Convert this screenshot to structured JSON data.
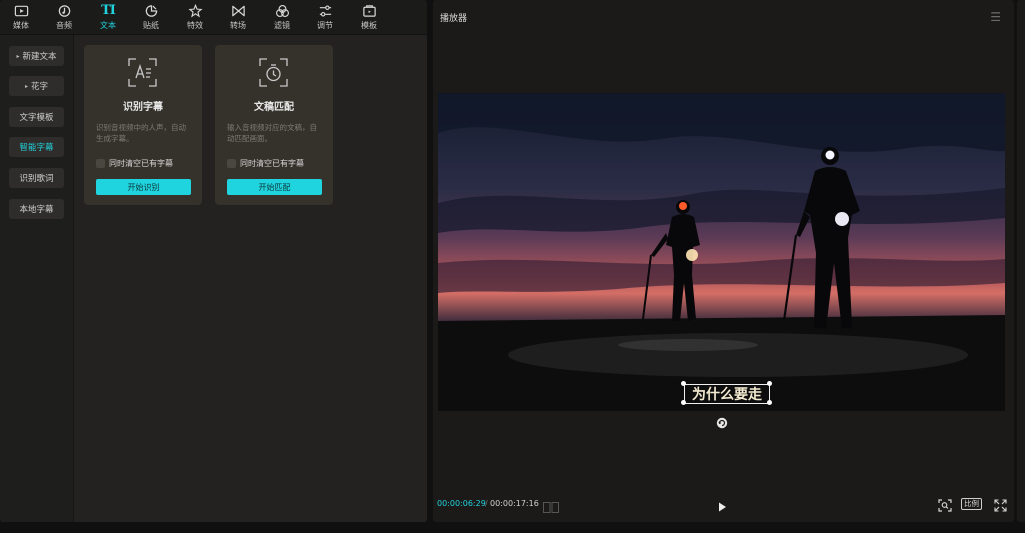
{
  "toolbar": {
    "tabs": [
      {
        "label": "媒体",
        "icon": "media-icon"
      },
      {
        "label": "音频",
        "icon": "audio-icon"
      },
      {
        "label": "文本",
        "icon": "text-icon",
        "active": true
      },
      {
        "label": "贴纸",
        "icon": "sticker-icon"
      },
      {
        "label": "特效",
        "icon": "effects-icon"
      },
      {
        "label": "转场",
        "icon": "transition-icon"
      },
      {
        "label": "滤镜",
        "icon": "filter-icon"
      },
      {
        "label": "调节",
        "icon": "adjust-icon"
      },
      {
        "label": "模板",
        "icon": "template-icon"
      }
    ],
    "text_glyph": "TI"
  },
  "sidebar": {
    "items": [
      {
        "label": "新建文本",
        "caret": "▸"
      },
      {
        "label": "花字",
        "caret": "▸"
      },
      {
        "label": "文字模板"
      },
      {
        "label": "智能字幕",
        "active": true
      },
      {
        "label": "识别歌词"
      },
      {
        "label": "本地字幕"
      }
    ]
  },
  "cards": [
    {
      "title": "识别字幕",
      "description": "识别音视频中的人声，自动生成字幕。",
      "checkbox": "同时清空已有字幕",
      "button": "开始识别",
      "icon": "caption-recognize-icon"
    },
    {
      "title": "文稿匹配",
      "description": "输入音视频对应的文稿，自动匹配画面。",
      "checkbox": "同时清空已有字幕",
      "button": "开始匹配",
      "icon": "script-match-icon"
    }
  ],
  "player": {
    "title": "播放器",
    "subtitle": "为什么要走",
    "current_time": "00:00:06:29",
    "separator": "/",
    "total_time": "00:00:17:16",
    "ratio_label": "比例"
  },
  "colors": {
    "accent": "#21d3dd",
    "panel": "#232220",
    "card": "#35322c"
  }
}
